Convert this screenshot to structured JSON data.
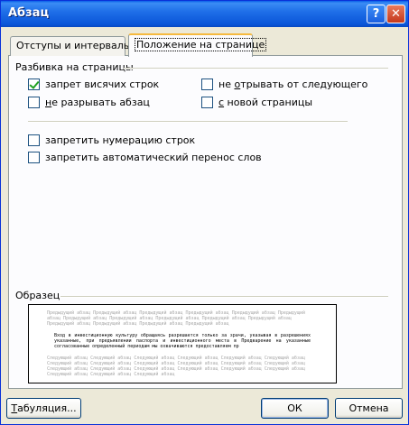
{
  "window": {
    "title": "Абзац"
  },
  "titlebar_buttons": {
    "help_label": "?",
    "close_label": "✕"
  },
  "tabs": [
    {
      "label": "Отступы и интервалы",
      "active": false
    },
    {
      "label": "Положение на странице",
      "active": true
    }
  ],
  "pagination": {
    "group_label": "Разбивка на страницы",
    "widow_control": {
      "label": "запрет висячих строк",
      "checked": true
    },
    "keep_with_next": {
      "label_prefix": "не ",
      "label_underlined": "о",
      "label_rest": "трывать от следующего",
      "checked": false
    },
    "keep_lines_together": {
      "label_prefix": "",
      "label_underlined": "н",
      "label_rest": "е разрывать абзац",
      "checked": false
    },
    "page_break_before": {
      "label_prefix": "",
      "label_underlined": "с",
      "label_rest": " новой страницы",
      "checked": false
    }
  },
  "options": {
    "suppress_line_numbers": {
      "label": "запретить нумерацию строк",
      "checked": false
    },
    "no_hyphenation": {
      "label": "запретить автоматический перенос слов",
      "checked": false
    }
  },
  "sample": {
    "label": "Образец",
    "prev_text": "Предыдущий абзац Предыдущий абзац Предыдущий абзац Предыдущий абзац Предыдущий абзац Предыдущий абзац Предыдущий абзац Предыдущий абзац Предыдущий абзац Предыдущий абзац Предыдущий абзац Предыдущий абзац Предыдущий абзац Предыдущий абзац Предыдущий абзац",
    "current_text": "Вход в инвестиционную культуру обращаясь разрешается только за зрачи, указывая в разрешениях указанные, при предъявлении паспорта и инвестиционного места в Предварение на указанные согласованные определенный периодам мы охвачиваются предоставляем пр",
    "next_text": "Следующий абзац Следующий абзац Следующий абзац Следующий абзац Следующий абзац Следующий абзац Следующий абзац Следующий абзац Следующий абзац Следующий абзац Следующий абзац Следующий абзац Следующий абзац Следующий абзац Следующий абзац Следующий абзац Следующий абзац Следующий абзац Следующий абзац Следующий абзац Следующий абзац"
  },
  "buttons": {
    "tabs_underlined": "Т",
    "tabs_rest": "абуляция...",
    "ok": "ОК",
    "cancel": "Отмена"
  }
}
